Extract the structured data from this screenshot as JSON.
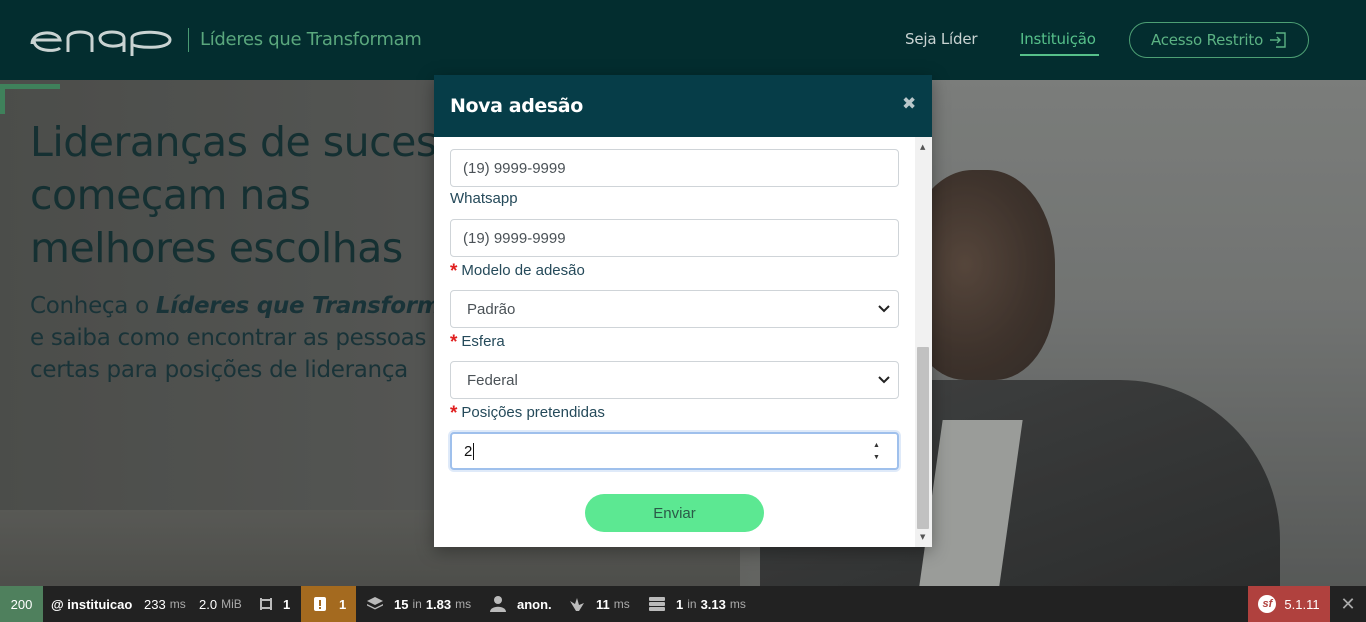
{
  "nav": {
    "tagline": "Líderes que Transformam",
    "links": [
      "Seja Líder",
      "Instituição"
    ],
    "login_label": "Acesso Restrito"
  },
  "hero": {
    "title_lines": [
      "Lideranças de sucesso",
      "começam nas",
      "melhores escolhas"
    ],
    "subtitle_prefix": "Conheça o ",
    "subtitle_emphasis": "Líderes que Transforma",
    "subtitle_lines": [
      "e saiba como encontrar as pessoas",
      "certas para posições de liderança"
    ]
  },
  "modal": {
    "title": "Nova adesão",
    "close_glyph": "✖",
    "phone_value": "(19) 9999-9999",
    "whatsapp_label": "Whatsapp",
    "whatsapp_value": "(19) 9999-9999",
    "model_label": "Modelo de adesão",
    "model_value": "Padrão",
    "sphere_label": "Esfera",
    "sphere_value": "Federal",
    "positions_label": "Posições pretendidas",
    "positions_value": "2",
    "submit_label": "Enviar",
    "required_mark": "*"
  },
  "toolbar": {
    "status": "200",
    "route": "@ instituicao",
    "time_value": "233",
    "time_unit": "ms",
    "memory_value": "2.0",
    "memory_unit": "MiB",
    "forms_count": "1",
    "warnings_count": "1",
    "twig_count": "15",
    "twig_in": "in",
    "twig_time": "1.83",
    "twig_unit": "ms",
    "user": "anon.",
    "events_time": "11",
    "events_unit": "ms",
    "db_count": "1",
    "db_in": "in",
    "db_time": "3.13",
    "db_unit": "ms",
    "version": "5.1.11",
    "sf_glyph": "sf",
    "close_glyph": "✕"
  },
  "colors": {
    "header_bg": "#032d2f",
    "accent_green": "#56c08a",
    "modal_header": "#063d48",
    "submit_bg": "#5ce892",
    "required": "#e01f1f"
  }
}
